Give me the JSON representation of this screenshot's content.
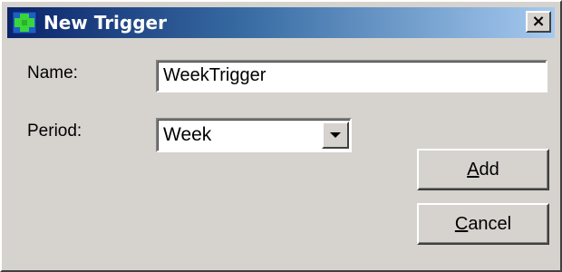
{
  "window": {
    "title": "New Trigger",
    "close_glyph": "×",
    "icon": "app-grid-icon"
  },
  "form": {
    "name_label": "Name:",
    "name_value": "WeekTrigger",
    "period_label": "Period:",
    "period_value": "Week"
  },
  "buttons": {
    "add": {
      "mnemonic": "A",
      "rest": "dd"
    },
    "cancel": {
      "mnemonic": "C",
      "rest": "ancel"
    }
  },
  "colors": {
    "titlebar_start": "#0a246a",
    "titlebar_end": "#a6caf0",
    "face": "#d6d3ce"
  }
}
